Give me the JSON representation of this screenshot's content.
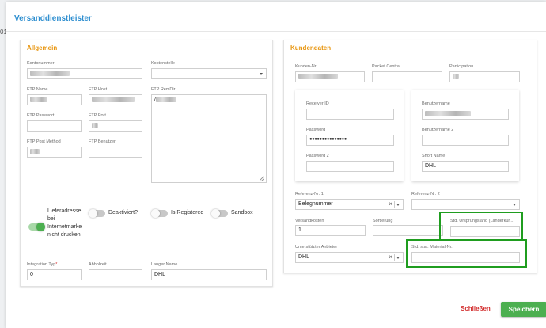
{
  "modal": {
    "title": "Versanddienstleister"
  },
  "background": {
    "edge_text": "01"
  },
  "allgemein": {
    "title": "Allgemein",
    "kontonummer": {
      "label": "Kontonummer",
      "value": ""
    },
    "kostenstelle": {
      "label": "Kostenstelle",
      "value": ""
    },
    "ftp_name": {
      "label": "FTP Name",
      "value": ""
    },
    "ftp_host": {
      "label": "FTP Host",
      "value": ""
    },
    "ftp_remdir": {
      "label": "FTP RemDir",
      "value": "/"
    },
    "ftp_passwort": {
      "label": "FTP Passwort",
      "value": ""
    },
    "ftp_port": {
      "label": "FTP Port",
      "value": ""
    },
    "ftp_post_method": {
      "label": "FTP Post Method",
      "value": ""
    },
    "ftp_benutzer": {
      "label": "FTP Benutzer",
      "value": ""
    },
    "toggles": {
      "lieferadresse": {
        "label_lines": [
          "Lieferadresse",
          "bei",
          "Internetmarke",
          "nicht drucken"
        ],
        "on": true
      },
      "deaktiviert": {
        "label": "Deaktiviert?",
        "on": false
      },
      "is_registered": {
        "label": "Is Registered",
        "on": false
      },
      "sandbox": {
        "label": "Sandbox",
        "on": false
      }
    },
    "integration_typ": {
      "label": "Integration Typ",
      "required_mark": "*",
      "value": "0"
    },
    "abholzeit": {
      "label": "Abholzeit",
      "value": ""
    },
    "langer_name": {
      "label": "Langer Name",
      "value": "DHL"
    }
  },
  "kundendaten": {
    "title": "Kundendaten",
    "kunden_nr": {
      "label": "Kunden-Nr.",
      "value": ""
    },
    "packet_central": {
      "label": "Packet Central",
      "value": ""
    },
    "participation": {
      "label": "Participation",
      "value": ""
    },
    "receiver_id": {
      "label": "Receiver ID",
      "value": ""
    },
    "password": {
      "label": "Password",
      "value": "●●●●●●●●●●●●●●●"
    },
    "password2": {
      "label": "Password 2",
      "value": ""
    },
    "benutzername": {
      "label": "Benutzername",
      "value": ""
    },
    "benutzername2": {
      "label": "Benutzername 2",
      "value": ""
    },
    "short_name": {
      "label": "Short Name",
      "value": "DHL"
    },
    "referenz1": {
      "label": "Referenz-Nr. 1",
      "value": "Belegnummer"
    },
    "referenz2": {
      "label": "Referenz-Nr. 2",
      "value": ""
    },
    "versandkosten": {
      "label": "Versandkosten",
      "value": "1"
    },
    "sortierung": {
      "label": "Sortierung",
      "value": ""
    },
    "std_ursprungsland": {
      "label": "Std. Ursprungsland (Länderkür...",
      "value": ""
    },
    "unterstuetzter_anbieter": {
      "label": "Unterstützter Anbieter",
      "value": "DHL"
    },
    "std_stat_material": {
      "label": "Std. stat. Material-Nr.",
      "value": ""
    }
  },
  "footer": {
    "close_label": "Schließen",
    "save_label": "Speichern"
  },
  "colors": {
    "accent_blue": "#2f8fd0",
    "section_orange": "#e8950e",
    "save_green": "#4caf50",
    "close_red": "#d32f2f",
    "highlight_green": "#1f9d1f"
  },
  "icons": {
    "clear": "×",
    "dropdown": "caret-down"
  }
}
